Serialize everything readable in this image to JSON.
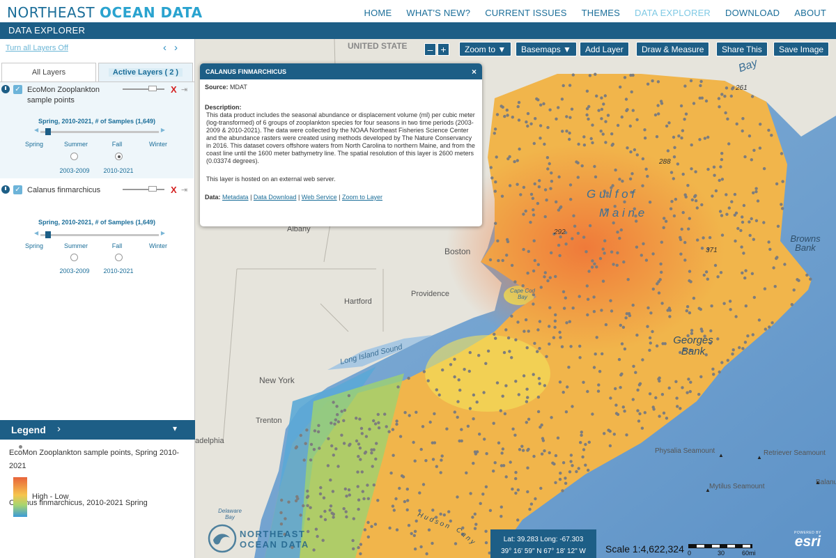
{
  "site": {
    "brand_regular": "NORTHEAST",
    "brand_bold": "OCEAN DATA",
    "nav": [
      "HOME",
      "WHAT'S NEW?",
      "CURRENT ISSUES",
      "THEMES",
      "DATA EXPLORER",
      "DOWNLOAD",
      "ABOUT"
    ],
    "active_nav": "DATA EXPLORER",
    "subtitle": "DATA EXPLORER"
  },
  "panel": {
    "turn_off_label": "Turn all Layers Off",
    "tabs": {
      "all": "All Layers",
      "active": "Active Layers ( 2 )"
    },
    "layers": [
      {
        "name": "EcoMon Zooplankton sample points",
        "time_caption": "Spring, 2010-2021, # of Samples (1,649)",
        "seasons": [
          "Spring",
          "Summer",
          "Fall",
          "Winter"
        ],
        "periods": [
          "2003-2009",
          "2010-2021"
        ],
        "selected_period": "2010-2021"
      },
      {
        "name": "Calanus finmarchicus",
        "time_caption": "Spring, 2010-2021, # of Samples (1,649)",
        "seasons": [
          "Spring",
          "Summer",
          "Fall",
          "Winter"
        ],
        "periods": [
          "2003-2009",
          "2010-2021"
        ]
      }
    ]
  },
  "legend": {
    "title": "Legend",
    "items": [
      "EcoMon Zooplankton sample points, Spring 2010-2021",
      "Calanus finmarchicus, 2010-2021 Spring"
    ],
    "ramp_label": "High - Low",
    "ramp_colors": [
      "#e8643a",
      "#f6c54e",
      "#a7d56f",
      "#3a9ad8"
    ]
  },
  "map": {
    "toolbar": {
      "zoom_out": "–",
      "zoom_in": "+",
      "zoom_to": "Zoom to ▼",
      "basemaps": "Basemaps ▼",
      "add_layer": "Add Layer",
      "draw_measure": "Draw & Measure",
      "share": "Share This",
      "save_image": "Save Image"
    },
    "labels": {
      "country": "UNITED STATE",
      "bay": "Bay",
      "gulf_of": "G u l f   o f",
      "maine": "M a i n e",
      "boston": "Boston",
      "albany": "Albany",
      "hartford": "Hartford",
      "providence": "Providence",
      "cape_cod_bay": "Cape Cod Bay",
      "long_island_sound": "Long Island Sound",
      "new_york": "New York",
      "trenton": "Trenton",
      "philadelphia": "adelphia",
      "delaware_bay": "Delaware Bay",
      "browns_bank": "Browns Bank",
      "georges_bank": "Georges Bank",
      "physalia": "Physalia Seamount",
      "retriever": "Retriever Seamount",
      "mytilus": "Mytilus Seamount",
      "balanus": "Balanus",
      "hudson": "H u d s o n",
      "canyon": "C a n y",
      "depths": [
        "261",
        "288",
        "292",
        "371"
      ]
    },
    "coords": {
      "decimal": "Lat: 39.283 Long: -67.303",
      "dms": "39° 16' 59\" N 67° 18' 12\" W"
    },
    "scale": {
      "text": "Scale 1:4,622,324",
      "ticks": [
        "0",
        "30",
        "60mi"
      ]
    },
    "esri": {
      "powered": "POWERED BY",
      "name": "esri"
    },
    "logo": {
      "line1": "NORTHEAST",
      "line2": "OCEAN DATA"
    }
  },
  "popup": {
    "title": "CALANUS FINMARCHICUS",
    "close": "×",
    "source_label": "Source:",
    "source_value": "MDAT",
    "description_label": "Description:",
    "description": "This data product includes the seasonal abundance or displacement volume (ml) per cubic meter (log-transformed) of 6 groups of zooplankton species for four seasons in two time periods (2003-2009 & 2010-2021). The data were collected by the NOAA Northeast Fisheries Science Center and the abundance rasters were created using methods developed by The Nature Conservancy in 2016. This dataset covers offshore waters from North Carolina to northern Maine, and from the coast line until the 1600 meter bathymetry line. The spatial resolution of this layer is 2600 meters (0.03374 degrees).",
    "hosted_note": "This layer is hosted on an external web server.",
    "data_label": "Data:",
    "links": [
      "Metadata",
      "Data Download",
      "Web Service",
      "Zoom to Layer"
    ]
  }
}
